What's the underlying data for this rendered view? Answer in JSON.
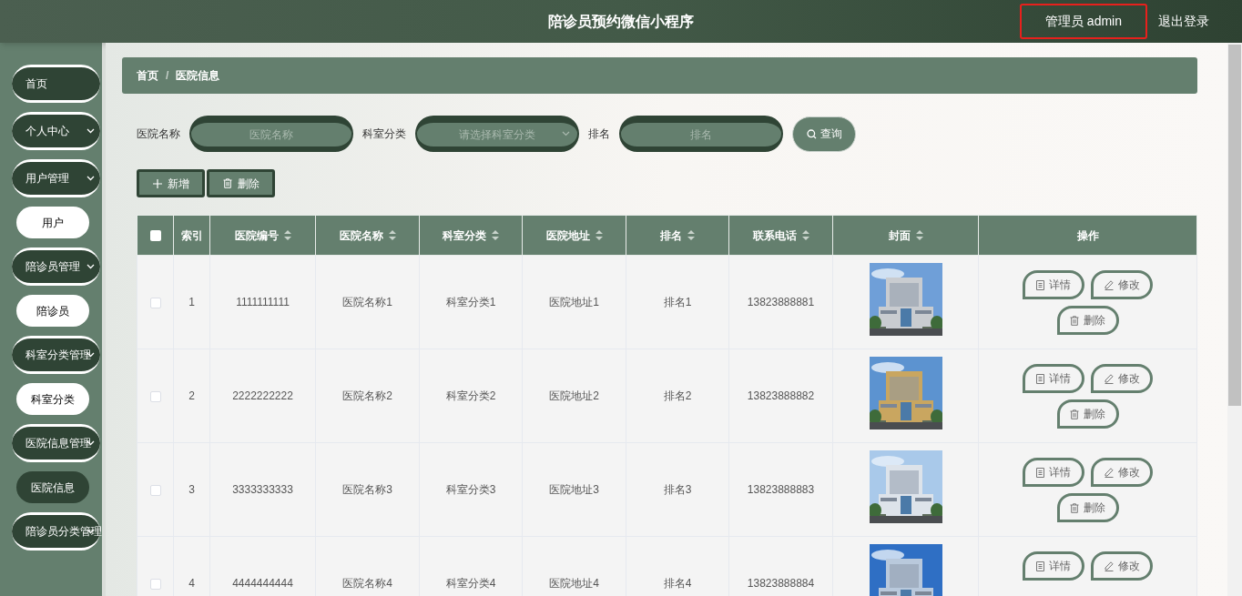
{
  "header": {
    "title": "陪诊员预约微信小程序",
    "user": "管理员 admin",
    "logout": "退出登录"
  },
  "sidebar": {
    "items": [
      {
        "label": "首页",
        "kind": "link"
      },
      {
        "label": "个人中心",
        "kind": "group"
      },
      {
        "label": "用户管理",
        "kind": "group",
        "children": [
          {
            "label": "用户",
            "selected": false
          }
        ]
      },
      {
        "label": "陪诊员管理",
        "kind": "group",
        "children": [
          {
            "label": "陪诊员",
            "selected": false
          }
        ]
      },
      {
        "label": "科室分类管理",
        "kind": "group",
        "children": [
          {
            "label": "科室分类",
            "selected": false
          }
        ]
      },
      {
        "label": "医院信息管理",
        "kind": "group",
        "children": [
          {
            "label": "医院信息",
            "selected": true
          }
        ]
      },
      {
        "label": "陪诊员分类管理",
        "kind": "group"
      }
    ]
  },
  "breadcrumb": {
    "items": [
      "首页",
      "医院信息"
    ],
    "separator": "/"
  },
  "search": {
    "fields": [
      {
        "label": "医院名称",
        "placeholder": "医院名称",
        "kind": "input"
      },
      {
        "label": "科室分类",
        "placeholder": "请选择科室分类",
        "kind": "select"
      },
      {
        "label": "排名",
        "placeholder": "排名",
        "kind": "input"
      }
    ],
    "button": "查询"
  },
  "actions": [
    {
      "label": "新增",
      "kind": "add"
    },
    {
      "label": "删除",
      "kind": "delete"
    }
  ],
  "table": {
    "select_all": {
      "checked": false
    },
    "columns": [
      {
        "label": "索引",
        "sortable": false
      },
      {
        "label": "医院编号",
        "sortable": true
      },
      {
        "label": "医院名称",
        "sortable": true
      },
      {
        "label": "科室分类",
        "sortable": true
      },
      {
        "label": "医院地址",
        "sortable": true
      },
      {
        "label": "排名",
        "sortable": true
      },
      {
        "label": "联系电话",
        "sortable": true
      },
      {
        "label": "封面",
        "sortable": true
      },
      {
        "label": "操作",
        "sortable": false
      }
    ],
    "rows": [
      {
        "selected": false,
        "cells": [
          "1",
          "1111111111",
          "医院名称1",
          "科室分类1",
          "医院地址1",
          "排名1",
          "13823888881"
        ],
        "cover": {
          "kind": "picture"
        },
        "buttons": [
          "详情",
          "修改",
          "删除"
        ]
      },
      {
        "selected": false,
        "cells": [
          "2",
          "2222222222",
          "医院名称2",
          "科室分类2",
          "医院地址2",
          "排名2",
          "13823888882"
        ],
        "cover": {
          "kind": "picture"
        },
        "buttons": [
          "详情",
          "修改",
          "删除"
        ]
      },
      {
        "selected": false,
        "cells": [
          "3",
          "3333333333",
          "医院名称3",
          "科室分类3",
          "医院地址3",
          "排名3",
          "13823888883"
        ],
        "cover": {
          "kind": "picture"
        },
        "buttons": [
          "详情",
          "修改",
          "删除"
        ]
      },
      {
        "selected": false,
        "cells": [
          "4",
          "4444444444",
          "医院名称4",
          "科室分类4",
          "医院地址4",
          "排名4",
          "13823888884"
        ],
        "cover": {
          "kind": "picture"
        },
        "buttons": [
          "详情",
          "修改"
        ]
      }
    ]
  }
}
